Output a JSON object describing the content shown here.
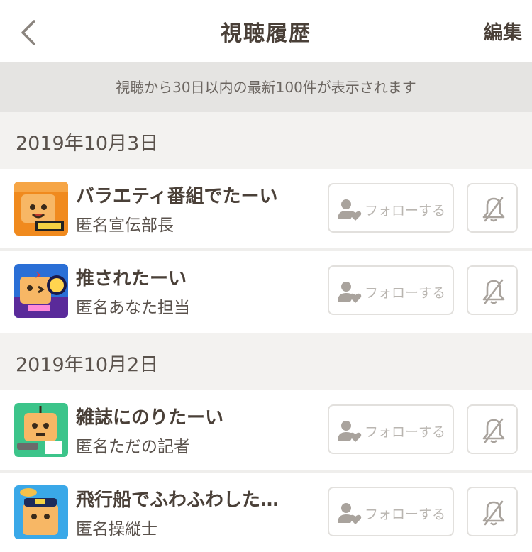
{
  "header": {
    "back_icon": "chevron-left-icon",
    "title": "視聴履歴",
    "edit_label": "編集"
  },
  "notice": "視聴から30日以内の最新100件が表示されます",
  "sections": [
    {
      "date": "2019年10月3日",
      "items": [
        {
          "title": "バラエティ番組でたーい",
          "author": "匿名宣伝部長",
          "follow_label": "フォローする",
          "thumb_color": "#f08a1e"
        },
        {
          "title": "推されたーい",
          "author": "匿名あなた担当",
          "follow_label": "フォローする",
          "thumb_color": "#2a6fd6"
        }
      ]
    },
    {
      "date": "2019年10月2日",
      "items": [
        {
          "title": "雑誌にのりたーい",
          "author": "匿名ただの記者",
          "follow_label": "フォローする",
          "thumb_color": "#3cc48a"
        },
        {
          "title": "飛行船でふわふわした…",
          "author": "匿名操縦士",
          "follow_label": "フォローする",
          "thumb_color": "#3aa8e8"
        }
      ]
    }
  ],
  "icons": {
    "follow": "person-heart-icon",
    "bell": "bell-muted-icon"
  },
  "colors": {
    "text": "#4a4038",
    "muted": "#b9b5b0",
    "notice_bg": "#e5e4e2",
    "date_bg": "#f3f2f0"
  }
}
